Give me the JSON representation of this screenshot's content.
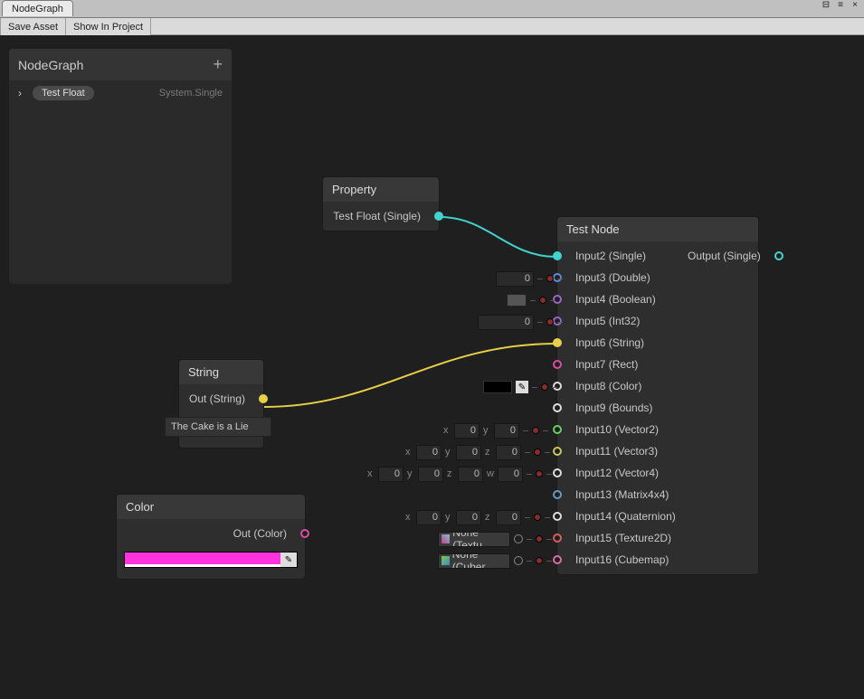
{
  "window": {
    "tab": "NodeGraph"
  },
  "toolbar": {
    "save": "Save Asset",
    "show": "Show In Project"
  },
  "panel": {
    "title": "NodeGraph",
    "item": {
      "name": "Test Float",
      "type": "System.Single"
    }
  },
  "nodes": {
    "property": {
      "title": "Property",
      "out": "Test Float (Single)"
    },
    "string": {
      "title": "String",
      "out": "Out (String)",
      "value": "The Cake is a Lie"
    },
    "color": {
      "title": "Color",
      "out": "Out (Color)",
      "hex": "#ff1fd6"
    },
    "test": {
      "title": "Test Node",
      "output": "Output (Single)",
      "inputs": [
        {
          "label": "Input2 (Single)",
          "color": "cyan",
          "filled": true
        },
        {
          "label": "Input3 (Double)",
          "color": "blue"
        },
        {
          "label": "Input4 (Boolean)",
          "color": "purple"
        },
        {
          "label": "Input5 (Int32)",
          "color": "purple"
        },
        {
          "label": "Input6 (String)",
          "color": "yellow",
          "filled": true
        },
        {
          "label": "Input7 (Rect)",
          "color": "magenta"
        },
        {
          "label": "Input8 (Color)",
          "color": "white"
        },
        {
          "label": "Input9 (Bounds)",
          "color": "white"
        },
        {
          "label": "Input10 (Vector2)",
          "color": "green"
        },
        {
          "label": "Input11 (Vector3)",
          "color": "olive"
        },
        {
          "label": "Input12 (Vector4)",
          "color": "white"
        },
        {
          "label": "Input13 (Matrix4x4)",
          "color": "steel"
        },
        {
          "label": "Input14 (Quaternion)",
          "color": "white"
        },
        {
          "label": "Input15 (Texture2D)",
          "color": "red"
        },
        {
          "label": "Input16 (Cubemap)",
          "color": "pink"
        }
      ]
    }
  },
  "ext": {
    "num0": "0",
    "x": "x",
    "y": "y",
    "z": "z",
    "w": "w",
    "noneTex": "None (Textu",
    "noneCube": "None (Cuber"
  }
}
